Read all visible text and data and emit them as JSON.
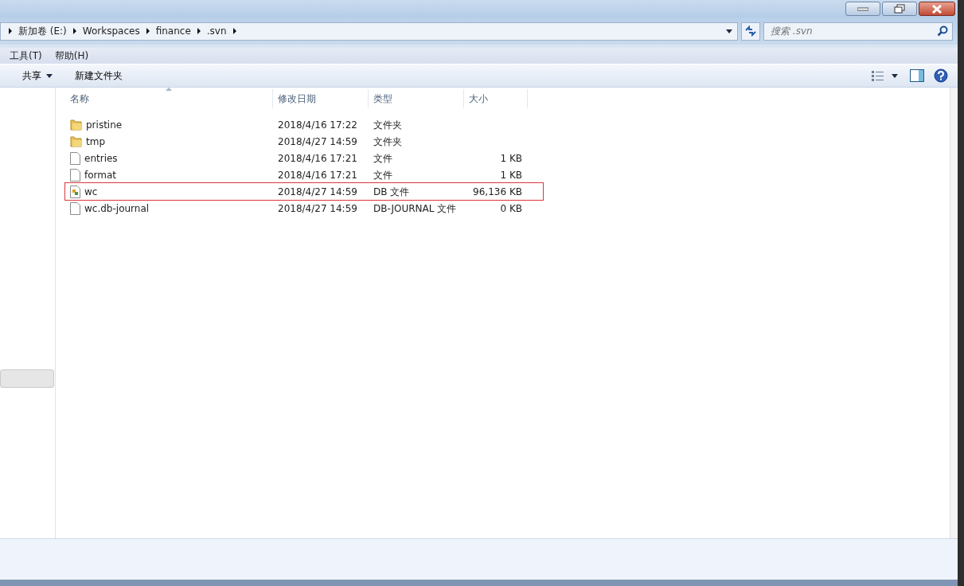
{
  "address": {
    "crumbs": [
      "新加卷 (E:)",
      "Workspaces",
      "finance",
      ".svn"
    ]
  },
  "search": {
    "placeholder": "搜索 .svn"
  },
  "menu": [
    "工具(T)",
    "帮助(H)"
  ],
  "toolbar": [
    {
      "label": "共享",
      "dropdown": true
    },
    {
      "label": "新建文件夹",
      "dropdown": false
    }
  ],
  "columns": [
    "名称",
    "修改日期",
    "类型",
    "大小"
  ],
  "rows": [
    {
      "name": "pristine",
      "kind": "folder",
      "date": "2018/4/16 17:22",
      "type": "文件夹",
      "size": "",
      "highlighted": false
    },
    {
      "name": "tmp",
      "kind": "folder",
      "date": "2018/4/27 14:59",
      "type": "文件夹",
      "size": "",
      "highlighted": false
    },
    {
      "name": "entries",
      "kind": "file",
      "date": "2018/4/16 17:21",
      "type": "文件",
      "size": "1 KB",
      "highlighted": false
    },
    {
      "name": "format",
      "kind": "file",
      "date": "2018/4/16 17:21",
      "type": "文件",
      "size": "1 KB",
      "highlighted": false
    },
    {
      "name": "wc",
      "kind": "db",
      "date": "2018/4/27 14:59",
      "type": "DB 文件",
      "size": "96,136 KB",
      "highlighted": true
    },
    {
      "name": "wc.db-journal",
      "kind": "file",
      "date": "2018/4/27 14:59",
      "type": "DB-JOURNAL 文件",
      "size": "0 KB",
      "highlighted": false
    }
  ]
}
